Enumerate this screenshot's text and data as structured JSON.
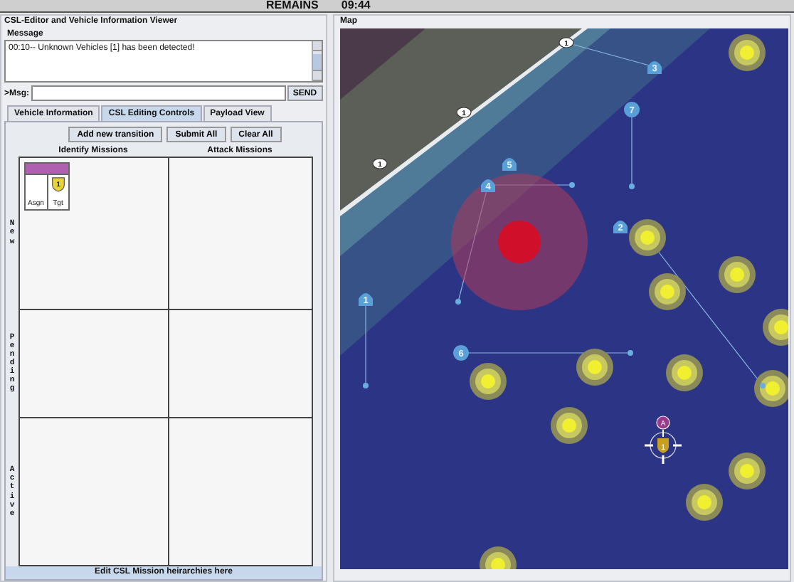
{
  "top_bar": {
    "label": "REMAINS",
    "time": "09:44"
  },
  "editor": {
    "title": "CSL-Editor and Vehicle Information Viewer",
    "message_label": "Message",
    "messages": [
      "00:10-- Unknown Vehicles [1] has been detected!"
    ],
    "msg_label": ">Msg:",
    "send_button": "SEND",
    "tabs": [
      {
        "label": "Vehicle Information",
        "selected": false
      },
      {
        "label": "CSL Editing Controls",
        "selected": true
      },
      {
        "label": "Payload View",
        "selected": false
      }
    ],
    "buttons": [
      "Add new transition",
      "Submit All",
      "Clear All"
    ],
    "columns": [
      "Identify Missions",
      "Attack Missions"
    ],
    "rows": [
      {
        "label": "New",
        "identify_missions": [
          {
            "assign_label": "Asgn",
            "target_label": "Tgt",
            "target_number": "1"
          }
        ]
      },
      {
        "label": "Pending"
      },
      {
        "label": "Active"
      }
    ],
    "footer": "Edit CSL Mission heirarchies here"
  },
  "map": {
    "title": "Map",
    "waypoints": [
      "1",
      "1",
      "1"
    ],
    "markers": [
      {
        "label": "3",
        "kind": "shield"
      },
      {
        "label": "7",
        "kind": "circle"
      },
      {
        "label": "5",
        "kind": "shield"
      },
      {
        "label": "4",
        "kind": "shield"
      },
      {
        "label": "2",
        "kind": "shield"
      },
      {
        "label": "1",
        "kind": "shield"
      },
      {
        "label": "6",
        "kind": "circle"
      }
    ],
    "vehicle": {
      "label": "1",
      "tag": "A"
    }
  }
}
